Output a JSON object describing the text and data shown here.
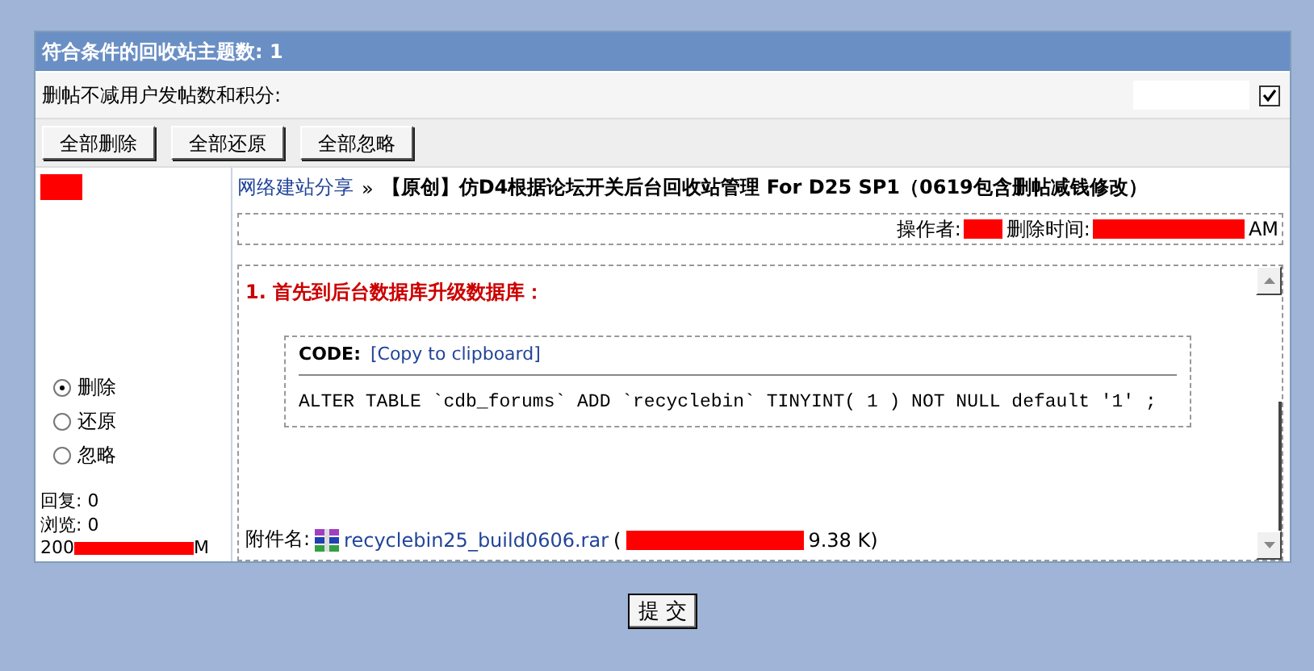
{
  "header": {
    "title": "符合条件的回收站主题数: 1"
  },
  "option": {
    "label": "删帖不减用户发帖数和积分:",
    "checked": true
  },
  "bulk_buttons": [
    "全部删除",
    "全部还原",
    "全部忽略"
  ],
  "actions": [
    {
      "label": "删除",
      "selected": true
    },
    {
      "label": "还原",
      "selected": false
    },
    {
      "label": "忽略",
      "selected": false
    }
  ],
  "stats": [
    "回复: 0",
    "浏览: 0"
  ],
  "date": {
    "start": "200",
    "end": "M"
  },
  "thread": {
    "forum": "网络建站分享",
    "separator": "»",
    "title": "【原创】仿D4根据论坛开关后台回收站管理 For D25 SP1（0619包含删帖减钱修改）"
  },
  "meta": {
    "operator_label": "操作者:",
    "delete_time_label": "删除时间:",
    "time_end": "AM"
  },
  "post": {
    "heading": "1. 首先到后台数据库升级数据库：",
    "code": {
      "label": "CODE:",
      "copy_link": "[Copy to clipboard]",
      "text": "ALTER TABLE `cdb_forums` ADD `recyclebin` TINYINT( 1 ) NOT NULL default '1' ;"
    },
    "attachment": {
      "label": "附件名:",
      "file": "recyclebin25_build0606.rar",
      "open": "(",
      "size": "9.38 K)"
    }
  },
  "submit": "提 交"
}
